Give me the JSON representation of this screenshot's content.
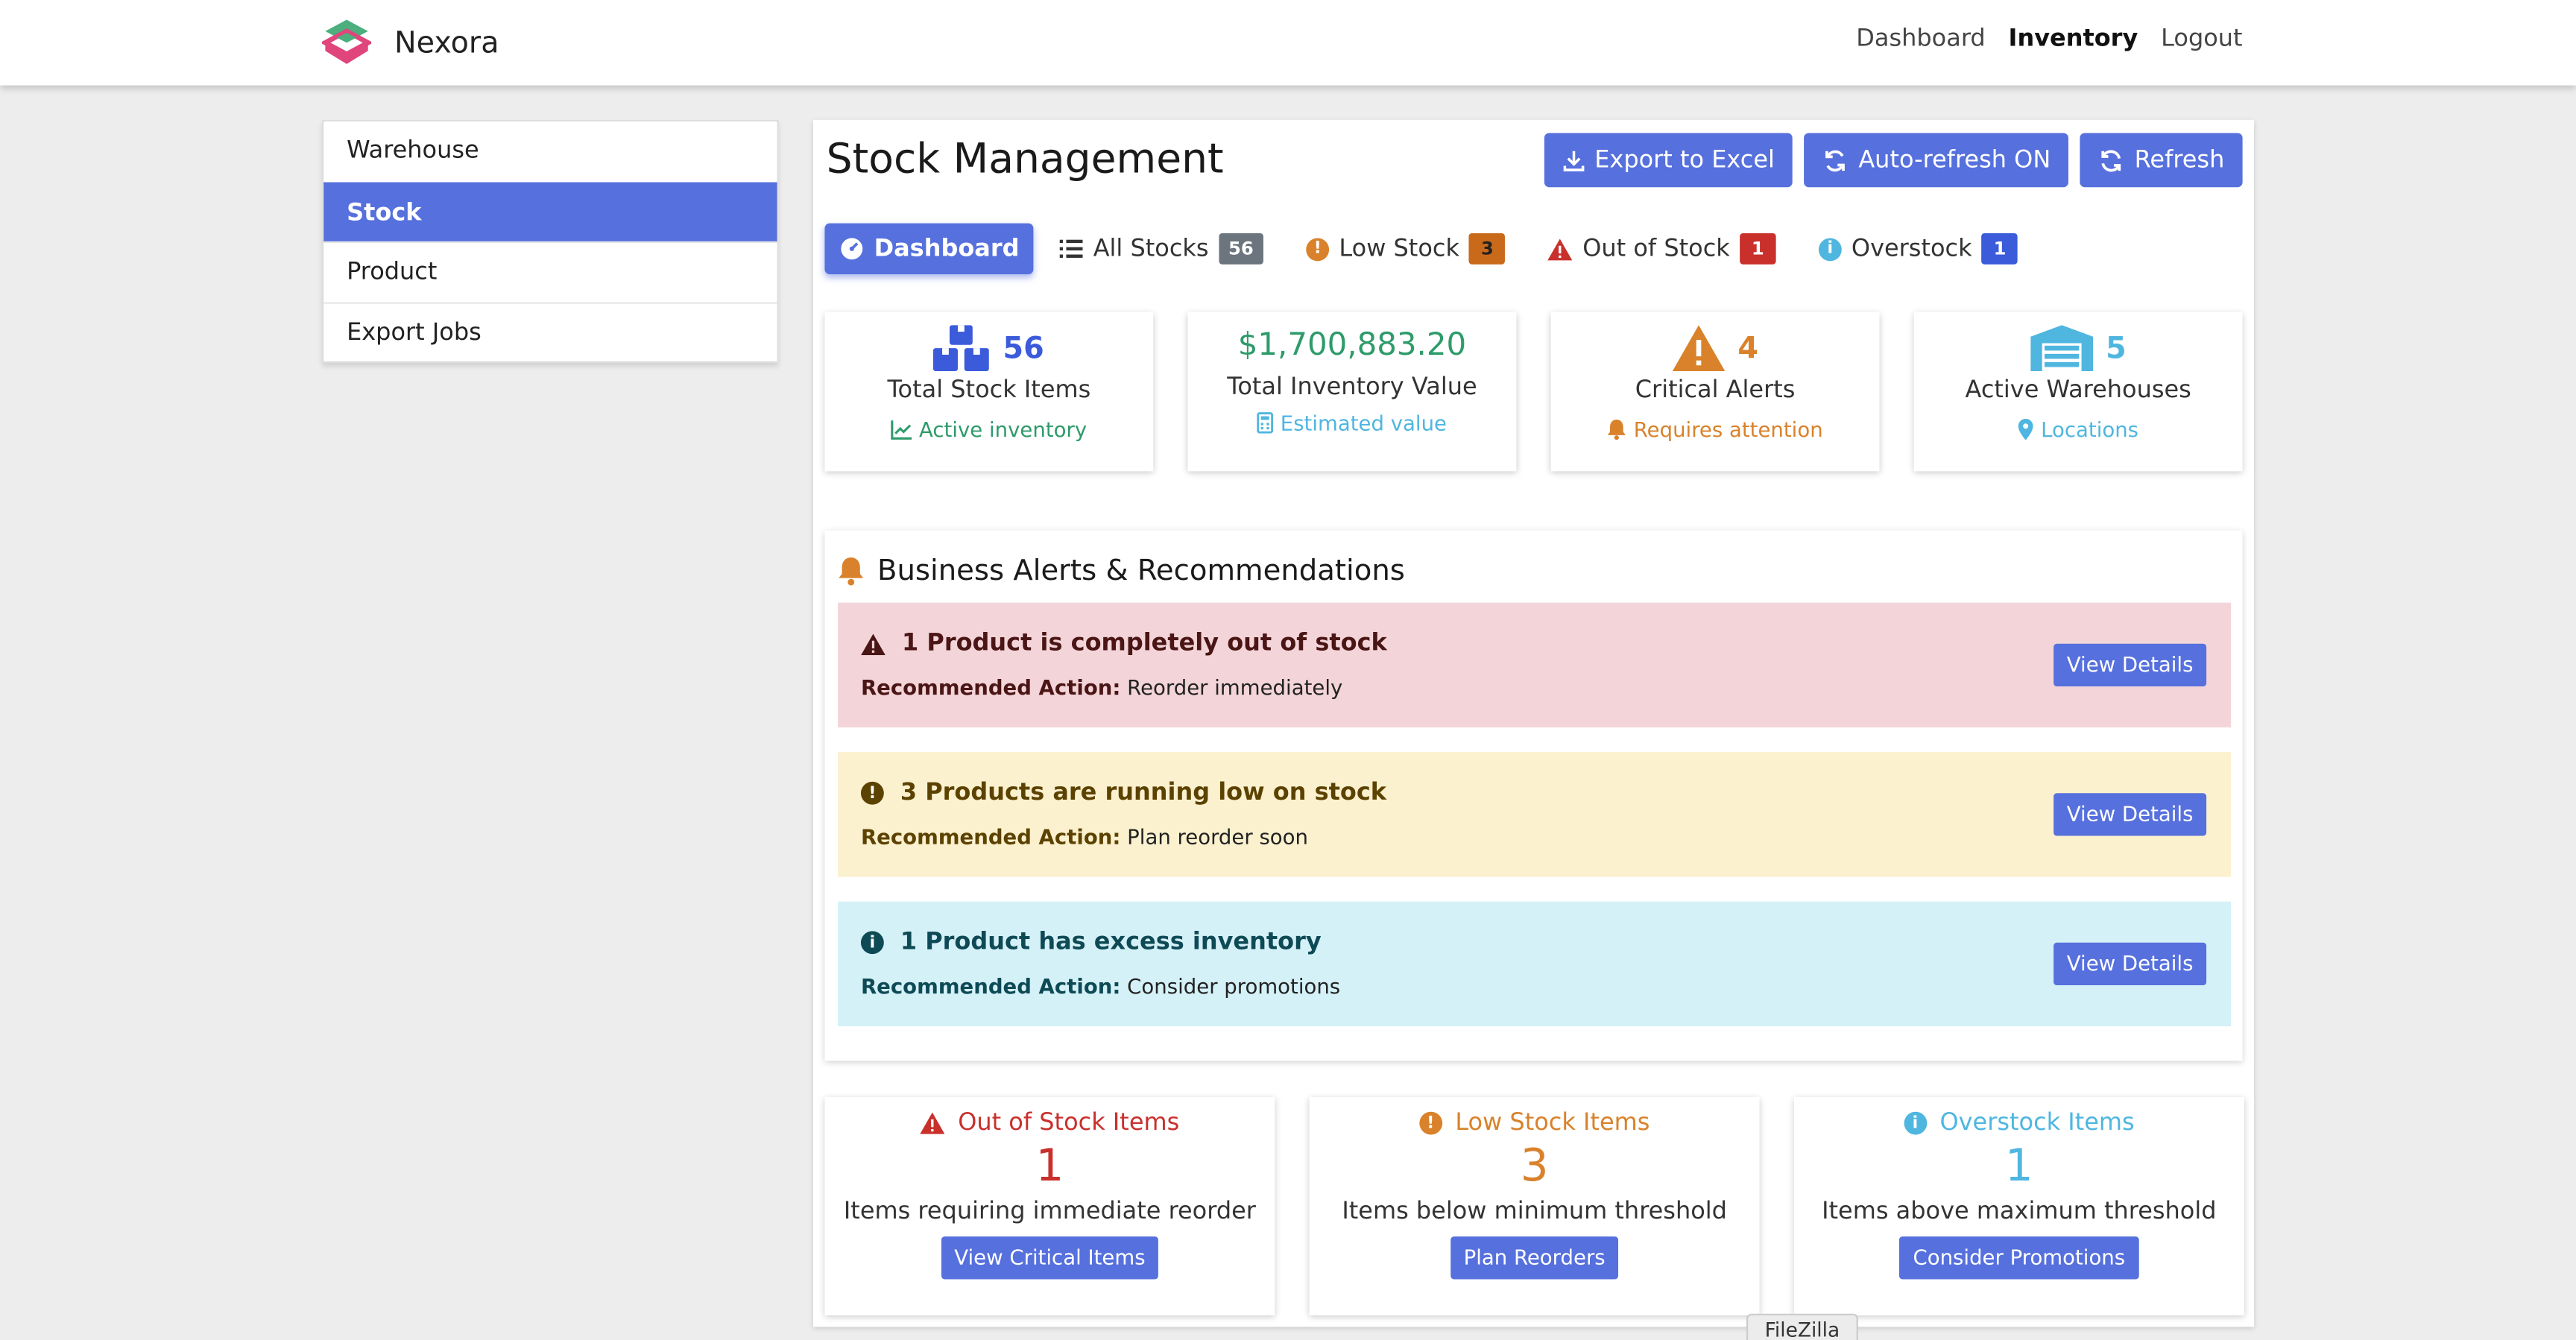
{
  "app": {
    "brand": "Nexora"
  },
  "nav": {
    "dashboard": "Dashboard",
    "inventory": "Inventory",
    "logout": "Logout"
  },
  "sidebar": {
    "items": [
      {
        "label": "Warehouse"
      },
      {
        "label": "Stock"
      },
      {
        "label": "Product"
      },
      {
        "label": "Export Jobs"
      }
    ]
  },
  "page": {
    "title": "Stock Management"
  },
  "toolbar": {
    "export": "Export to Excel",
    "autorefresh": "Auto-refresh ON",
    "refresh": "Refresh"
  },
  "tabs": [
    {
      "label": "Dashboard"
    },
    {
      "label": "All Stocks",
      "count": "56"
    },
    {
      "label": "Low Stock",
      "count": "3"
    },
    {
      "label": "Out of Stock",
      "count": "1"
    },
    {
      "label": "Overstock",
      "count": "1"
    }
  ],
  "stats": [
    {
      "value": "56",
      "label": "Total Stock Items",
      "sub": "Active inventory"
    },
    {
      "value": "$1,700,883.20",
      "label": "Total Inventory Value",
      "sub": "Estimated value"
    },
    {
      "value": "4",
      "label": "Critical Alerts",
      "sub": "Requires attention"
    },
    {
      "value": "5",
      "label": "Active Warehouses",
      "sub": "Locations"
    }
  ],
  "alerts": {
    "heading": "Business Alerts & Recommendations",
    "rec_label": "Recommended Action:",
    "items": [
      {
        "title": "1 Product is completely out of stock",
        "action": "Reorder immediately",
        "button": "View Details"
      },
      {
        "title": "3 Products are running low on stock",
        "action": "Plan reorder soon",
        "button": "View Details"
      },
      {
        "title": "1 Product has excess inventory",
        "action": "Consider promotions",
        "button": "View Details"
      }
    ]
  },
  "summary": [
    {
      "title": "Out of Stock Items",
      "value": "1",
      "desc": "Items requiring immediate reorder",
      "button": "View Critical Items"
    },
    {
      "title": "Low Stock Items",
      "value": "3",
      "desc": "Items below minimum threshold",
      "button": "Plan Reorders"
    },
    {
      "title": "Overstock Items",
      "value": "1",
      "desc": "Items above maximum threshold",
      "button": "Consider Promotions"
    }
  ],
  "tooltip": "FileZilla",
  "colors": {
    "accent": "#5670dd",
    "danger": "#c9302c",
    "warning": "#d9822b",
    "info": "#4fb6e0",
    "success": "#2e9b6a",
    "badge_gray": "#6c757d",
    "badge_orange": "#c96a1b",
    "badge_red": "#c9302c",
    "badge_blue": "#3b5bdb"
  }
}
